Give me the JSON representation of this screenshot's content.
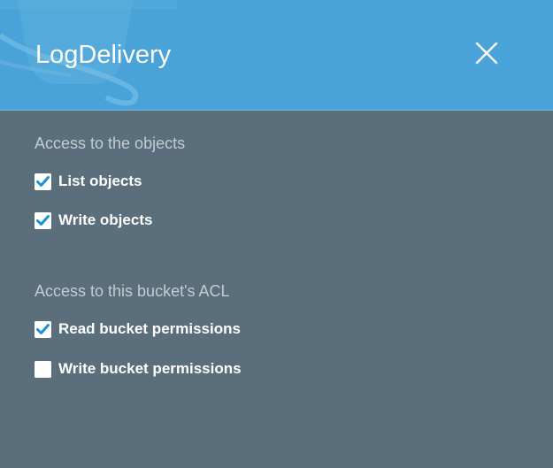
{
  "dialog": {
    "title": "LogDelivery",
    "close_icon": "close-icon"
  },
  "sections": [
    {
      "heading": "Access to the objects",
      "options": [
        {
          "label": "List objects",
          "checked": true
        },
        {
          "label": "Write objects",
          "checked": true
        }
      ]
    },
    {
      "heading": "Access to this bucket's ACL",
      "options": [
        {
          "label": "Read bucket permissions",
          "checked": true
        },
        {
          "label": "Write bucket permissions",
          "checked": false
        }
      ]
    }
  ],
  "colors": {
    "header_bg": "#4aa3d8",
    "body_bg": "#5a6f7b",
    "check_color": "#1e90d8",
    "heading_text": "#c3ccd1"
  }
}
